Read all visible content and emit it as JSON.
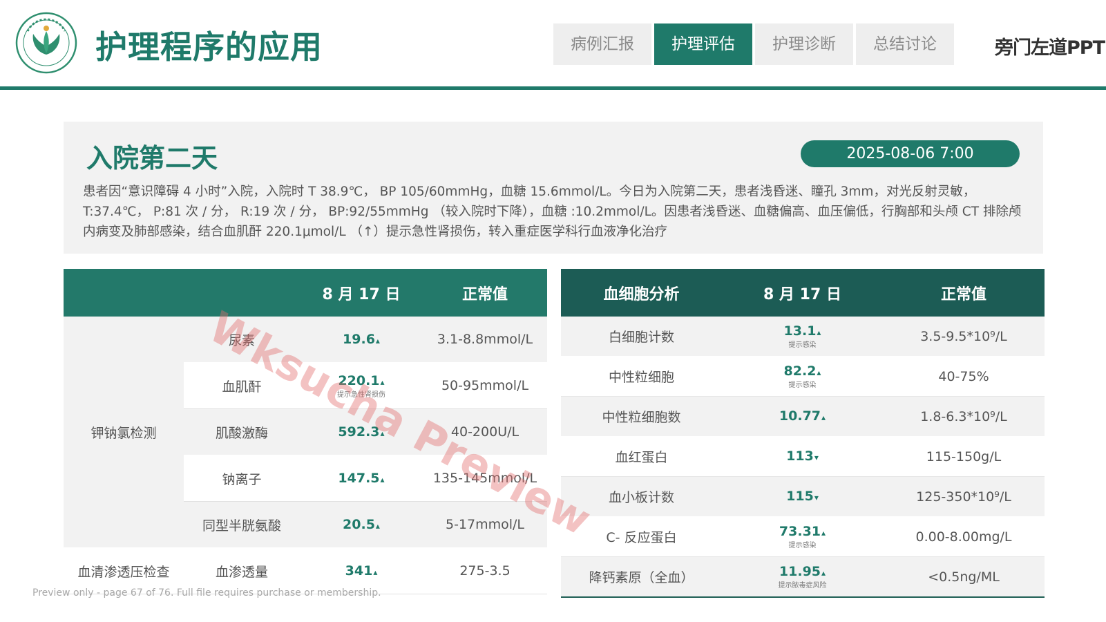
{
  "header": {
    "title": "护理程序的应用",
    "tabs": [
      {
        "label": "病例汇报",
        "active": false
      },
      {
        "label": "护理评估",
        "active": true
      },
      {
        "label": "护理诊断",
        "active": false
      },
      {
        "label": "总结讨论",
        "active": false
      }
    ],
    "brand": "旁门左道PPT",
    "accent_color": "#1f7a6a"
  },
  "intro": {
    "heading": "入院第二天",
    "datetime": "2025-08-06  7:00",
    "text": "患者因“意识障碍 4 小时”入院，入院时 T 38.9℃， BP 105/60mmHg，血糖 15.6mmol/L。今日为入院第二天，患者浅昏迷、瞳孔 3mm，对光反射灵敏，T:37.4℃， P:81 次 / 分， R:19 次 / 分， BP:92/55mmHg （较入院时下降），血糖 :10.2mmol/L。因患者浅昏迷、血糖偏高、血压偏低，行胸部和头颅 CT 排除颅内病变及肺部感染，结合血肌酐 220.1μmol/L （↑）提示急性肾损伤，转入重症医学科行血液净化治疗"
  },
  "left_table": {
    "headers": [
      "",
      "",
      "8 月 17 日",
      "正常值"
    ],
    "group1": "钾钠氯检测",
    "group2": "血清渗透压检查",
    "rows": [
      {
        "name": "尿素",
        "value": "19.6",
        "arrow": "▴",
        "note": "",
        "normal": "3.1-8.8mmol/L"
      },
      {
        "name": "血肌酐",
        "value": "220.1",
        "arrow": "▴",
        "note": "提示急性肾损伤",
        "normal": "50-95mmol/L"
      },
      {
        "name": "肌酸激酶",
        "value": "592.3",
        "arrow": "▴",
        "note": "",
        "normal": "40-200U/L"
      },
      {
        "name": "钠离子",
        "value": "147.5",
        "arrow": "▴",
        "note": "",
        "normal": "135-145mmol/L"
      },
      {
        "name": "同型半胱氨酸",
        "value": "20.5",
        "arrow": "▴",
        "note": "",
        "normal": "5-17mmol/L"
      },
      {
        "name": "血渗透量",
        "value": "341",
        "arrow": "▴",
        "note": "",
        "normal": "275-3.5"
      }
    ]
  },
  "right_table": {
    "headers": [
      "血细胞分析",
      "8 月 17 日",
      "正常值"
    ],
    "rows": [
      {
        "name": "白细胞计数",
        "value": "13.1",
        "arrow": "▴",
        "note": "提示感染",
        "normal": "3.5-9.5*10⁹/L"
      },
      {
        "name": "中性粒细胞",
        "value": "82.2",
        "arrow": "▴",
        "note": "提示感染",
        "normal": "40-75%"
      },
      {
        "name": "中性粒细胞数",
        "value": "10.77",
        "arrow": "▴",
        "note": "",
        "normal": "1.8-6.3*10⁹/L"
      },
      {
        "name": "血红蛋白",
        "value": "113",
        "arrow": "▾",
        "note": "",
        "normal": "115-150g/L"
      },
      {
        "name": "血小板计数",
        "value": "115",
        "arrow": "▾",
        "note": "",
        "normal": "125-350*10⁹/L"
      },
      {
        "name": "C- 反应蛋白",
        "value": "73.31",
        "arrow": "▴",
        "note": "提示感染",
        "normal": "0.00-8.00mg/L"
      },
      {
        "name": "降钙素原（全血）",
        "value": "11.95",
        "arrow": "▴",
        "note": "提示脓毒症风险",
        "normal": "<0.5ng/ML"
      }
    ]
  },
  "watermark": "Wksucha Preview",
  "footer_note": "Preview only - page 67 of 76. Full file requires purchase or membership."
}
